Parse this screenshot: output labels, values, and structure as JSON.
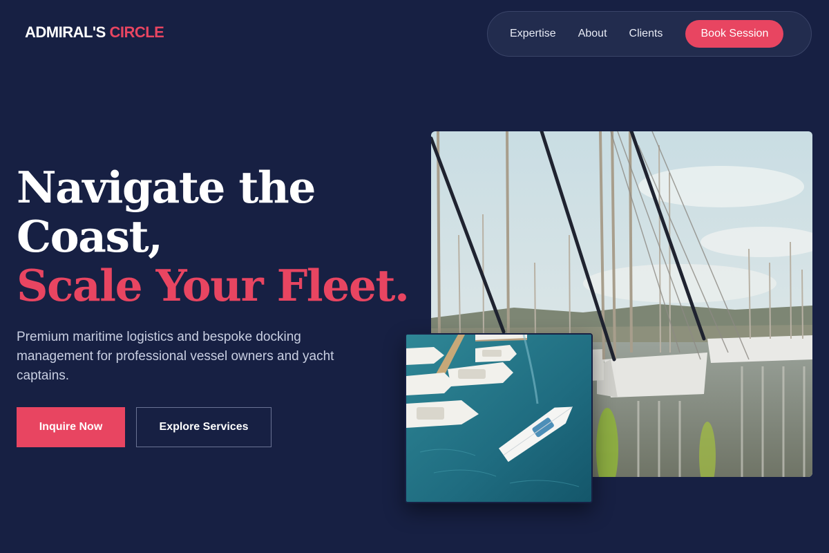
{
  "brand": {
    "name_part1": "ADMIRAL'S",
    "name_part2": "CIRCLE"
  },
  "nav": {
    "links": [
      "Expertise",
      "About",
      "Clients"
    ],
    "cta": "Book Session"
  },
  "hero": {
    "title_line1": "Navigate the",
    "title_line2": "Coast,",
    "title_line3": "Scale Your Fleet.",
    "subtitle": "Premium maritime logistics and bespoke docking management for professional vessel owners and yacht captains.",
    "primary_button": "Inquire Now",
    "secondary_button": "Explore Services"
  },
  "colors": {
    "background": "#172043",
    "accent": "#e84561",
    "nav_pill": "#222c4e"
  },
  "images": {
    "main": "marina-masts-photo",
    "inset": "aerial-marina-yacht-photo"
  }
}
